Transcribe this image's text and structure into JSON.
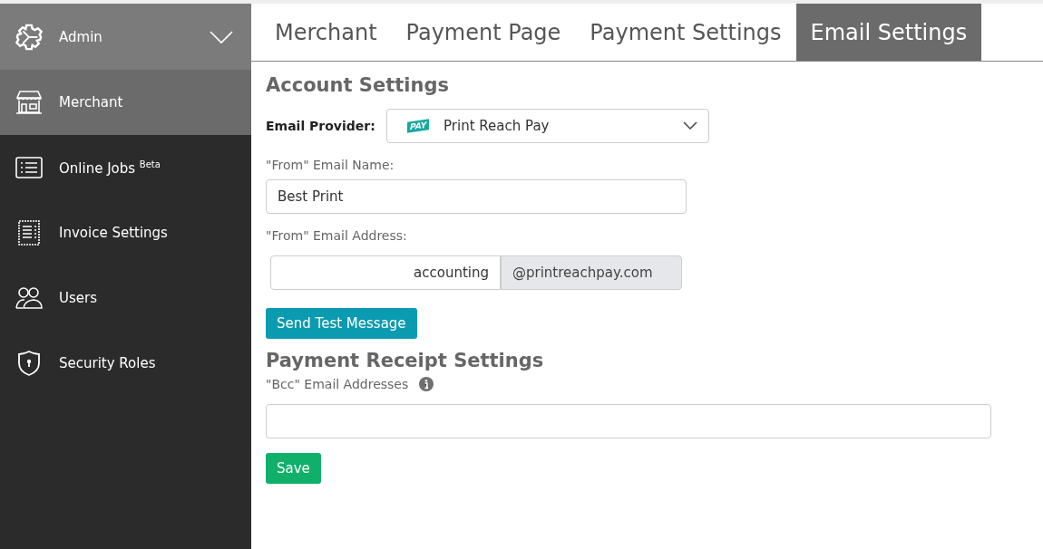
{
  "sidebar": {
    "header": {
      "label": "Admin",
      "expanded": true
    },
    "items": [
      {
        "label": "Merchant",
        "selected": true
      },
      {
        "label": "Online Jobs $^{Beta}$",
        "selected": false
      },
      {
        "label": "Invoice Settings",
        "selected": false
      },
      {
        "label": "Users",
        "selected": false
      },
      {
        "label": "Security Roles",
        "selected": false
      }
    ]
  },
  "tabs": [
    {
      "label": "Merchant",
      "selected": false
    },
    {
      "label": "Payment Page",
      "selected": false
    },
    {
      "label": "Payment Settings",
      "selected": false
    },
    {
      "label": "Email Settings",
      "selected": true
    }
  ],
  "account_settings": {
    "title": "Account Settings",
    "provider_label": "Email Provider:",
    "provider": {
      "logo_text": "PAY",
      "value": "Print Reach Pay"
    },
    "from_name_label": "\"From\" Email Name:",
    "from_name": "Best Print",
    "from_address_label": "\"From\" Email Address:",
    "from_address": "accounting",
    "domain": "@printreachpay.com",
    "test_button": "Send Test Message"
  },
  "receipt_settings": {
    "title": "Payment Receipt Settings",
    "bcc_label": "\"Bcc\" Email Addresses",
    "save_button": "Save"
  }
}
